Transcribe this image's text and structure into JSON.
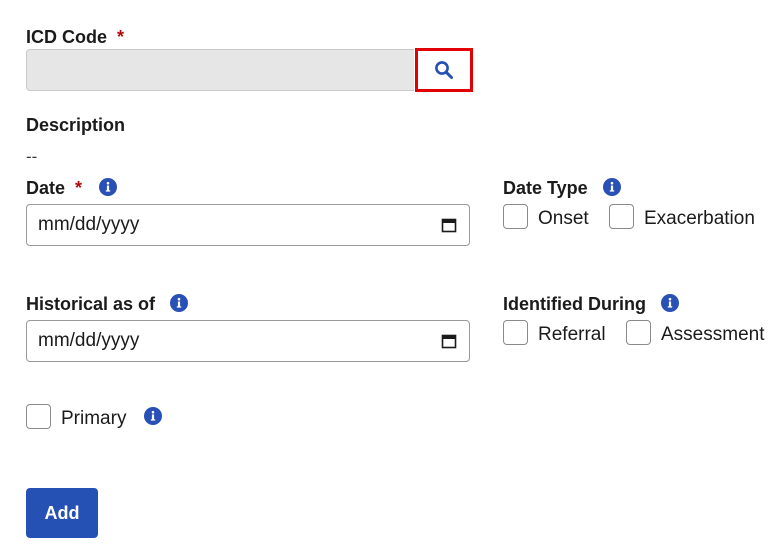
{
  "icd": {
    "label": "ICD Code",
    "required": "*",
    "value": ""
  },
  "description": {
    "label": "Description",
    "value": "--"
  },
  "date": {
    "label": "Date",
    "required": "*",
    "placeholder": "mm/dd/yyyy"
  },
  "date_type": {
    "label": "Date Type",
    "options": [
      "Onset",
      "Exacerbation"
    ]
  },
  "historical": {
    "label": "Historical as of",
    "placeholder": "mm/dd/yyyy"
  },
  "identified_during": {
    "label": "Identified During",
    "options": [
      "Referral",
      "Assessment"
    ]
  },
  "primary": {
    "label": "Primary"
  },
  "actions": {
    "add_label": "Add"
  },
  "colors": {
    "accent": "#2550b4",
    "required": "#b50909",
    "highlight": "#e30000",
    "readonly_bg": "#e6e6e6"
  },
  "icons": [
    "search-icon",
    "info-icon",
    "calendar-icon"
  ]
}
